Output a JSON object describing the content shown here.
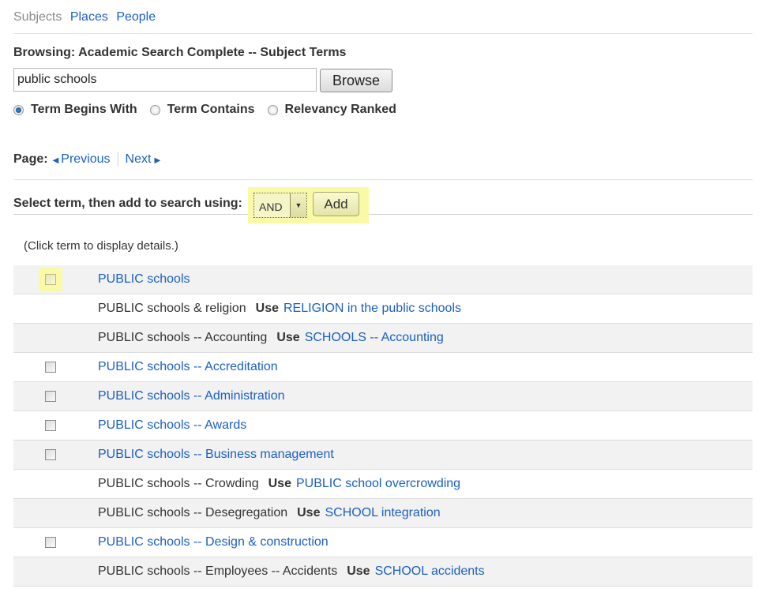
{
  "tabs": [
    {
      "label": "Subjects",
      "active": true
    },
    {
      "label": "Places",
      "active": false
    },
    {
      "label": "People",
      "active": false
    }
  ],
  "browsing_title": "Browsing: Academic Search Complete -- Subject Terms",
  "search": {
    "value": "public schools"
  },
  "browse_label": "Browse",
  "radio_options": [
    {
      "label": "Term Begins With",
      "checked": true
    },
    {
      "label": "Term Contains",
      "checked": false
    },
    {
      "label": "Relevancy Ranked",
      "checked": false
    }
  ],
  "pager": {
    "label": "Page:",
    "previous": "Previous",
    "next": "Next"
  },
  "select_label": "Select term, then add to search using:",
  "operator": {
    "value": "AND"
  },
  "add_label": "Add",
  "hint": "(Click term to display details.)",
  "use_label": "Use",
  "terms": [
    {
      "term": "PUBLIC schools",
      "checkbox": true,
      "highlighted": true,
      "use": null
    },
    {
      "term": "PUBLIC schools & religion",
      "checkbox": false,
      "use": "RELIGION in the public schools"
    },
    {
      "term": "PUBLIC schools -- Accounting",
      "checkbox": false,
      "use": "SCHOOLS -- Accounting"
    },
    {
      "term": "PUBLIC schools -- Accreditation",
      "checkbox": true,
      "use": null
    },
    {
      "term": "PUBLIC schools -- Administration",
      "checkbox": true,
      "use": null
    },
    {
      "term": "PUBLIC schools -- Awards",
      "checkbox": true,
      "use": null
    },
    {
      "term": "PUBLIC schools -- Business management",
      "checkbox": true,
      "use": null
    },
    {
      "term": "PUBLIC schools -- Crowding",
      "checkbox": false,
      "use": "PUBLIC school overcrowding"
    },
    {
      "term": "PUBLIC schools -- Desegregation",
      "checkbox": false,
      "use": "SCHOOL integration"
    },
    {
      "term": "PUBLIC schools -- Design & construction",
      "checkbox": true,
      "use": null
    },
    {
      "term": "PUBLIC schools -- Employees -- Accidents",
      "checkbox": false,
      "use": "SCHOOL accidents"
    }
  ],
  "colors": {
    "link": "#1a5fc4",
    "highlight": "#fafaa6",
    "row_alt": "#f2f2f2"
  }
}
